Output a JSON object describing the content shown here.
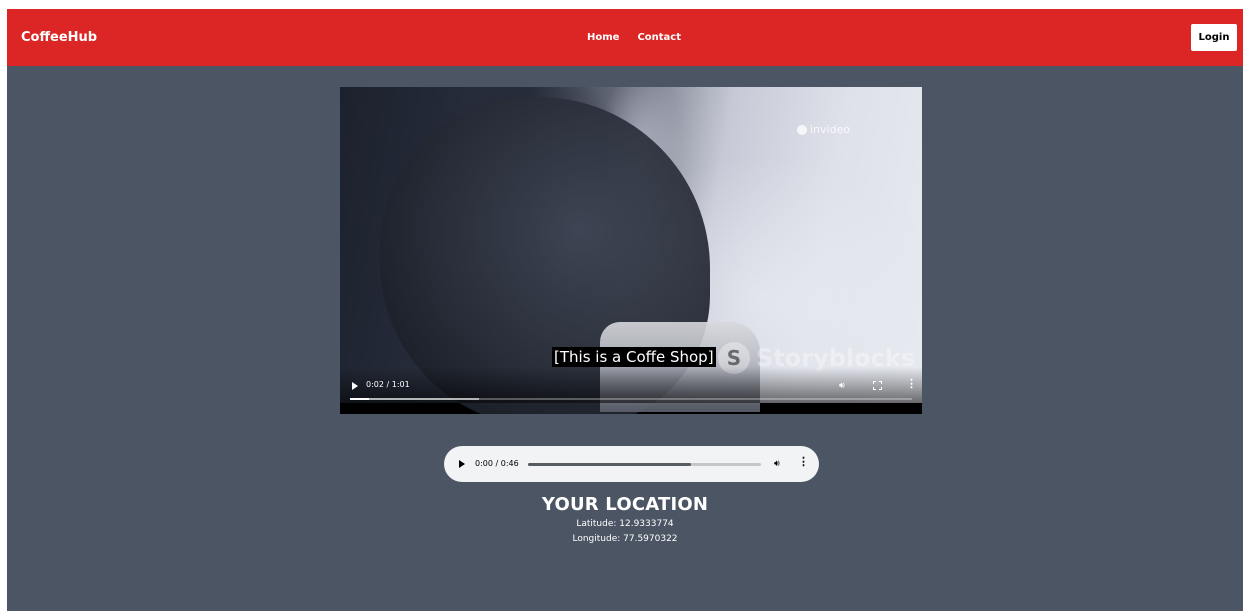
{
  "navbar": {
    "brand": "CoffeeHub",
    "links": [
      "Home",
      "Contact"
    ],
    "login_label": "Login"
  },
  "video": {
    "watermark": "invideo",
    "caption": "[This is a Coffe Shop]",
    "storyblocks": "Storyblocks",
    "time": "0:02 / 1:01",
    "progress_fraction": 0.033,
    "buffered_fraction": 0.23,
    "icons": {
      "play": "play-icon",
      "volume": "volume-icon",
      "fullscreen": "fullscreen-icon",
      "more": "more-options-icon"
    }
  },
  "audio": {
    "time": "0:00 / 0:46",
    "progress_fraction": 0.0,
    "buffered_fraction": 0.7,
    "icons": {
      "play": "play-icon",
      "volume": "volume-icon",
      "more": "more-options-icon"
    }
  },
  "location": {
    "title": "YOUR LOCATION",
    "latitude": "Latitude: 12.9333774",
    "longitude": "Longitude: 77.5970322"
  },
  "colors": {
    "navbar": "#dc2626",
    "background": "#4b5563",
    "audio_bg": "#f1f3f4"
  }
}
